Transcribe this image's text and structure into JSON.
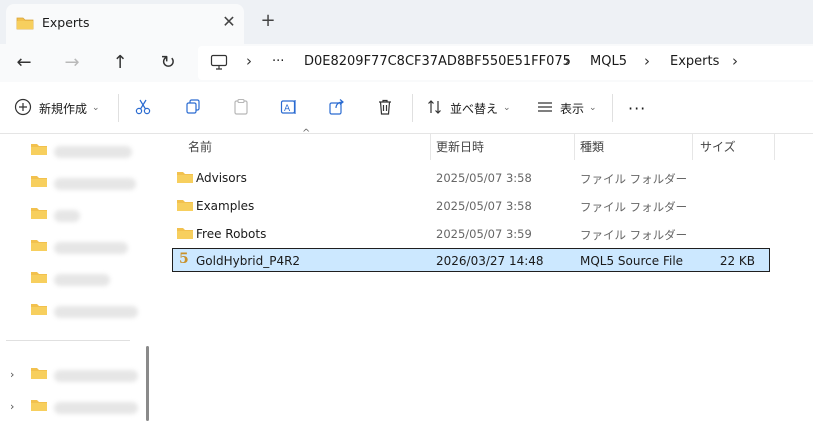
{
  "window": {
    "tab_label": "Experts",
    "tab_close": "✕",
    "new_tab": "+"
  },
  "nav": {
    "back": "←",
    "forward": "→",
    "up": "↑",
    "refresh": "↻"
  },
  "address": {
    "more": "···",
    "segments": [
      "D0E8209F77C8CF37AD8BF550E51FF075",
      "MQL5",
      "Experts"
    ],
    "sep": "›"
  },
  "toolbar": {
    "new_label": "新規作成",
    "sort_label": "並べ替え",
    "view_label": "表示",
    "more": "···"
  },
  "columns": {
    "name": "名前",
    "modified": "更新日時",
    "type": "種類",
    "size": "サイズ"
  },
  "files": [
    {
      "name": "Advisors",
      "modified": "2025/05/07 3:58",
      "type": "ファイル フォルダー",
      "size": ""
    },
    {
      "name": "Examples",
      "modified": "2025/05/07 3:58",
      "type": "ファイル フォルダー",
      "size": ""
    },
    {
      "name": "Free Robots",
      "modified": "2025/05/07 3:59",
      "type": "ファイル フォルダー",
      "size": ""
    },
    {
      "name": "GoldHybrid_P4R2",
      "modified": "2026/03/27 14:48",
      "type": "MQL5 Source File",
      "size": "22 KB"
    }
  ],
  "mql_icon_glyph": "5",
  "colors": {
    "folder": "#f2c14e",
    "selection": "#cce8ff",
    "accent": "#0067c0"
  }
}
